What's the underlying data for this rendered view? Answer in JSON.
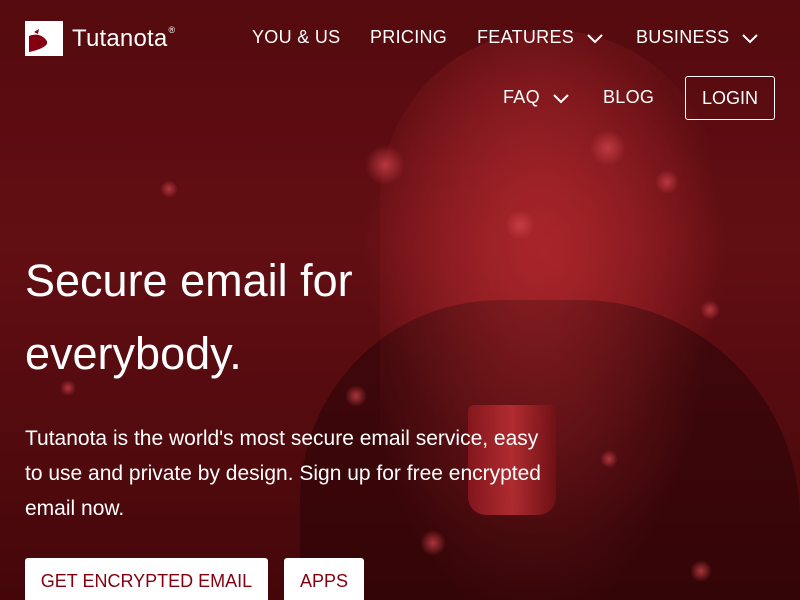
{
  "brand": {
    "logo_text": "Tutanota",
    "registered_mark": "®"
  },
  "nav": {
    "items": [
      {
        "label": "YOU & US",
        "has_dropdown": false
      },
      {
        "label": "PRICING",
        "has_dropdown": false
      },
      {
        "label": "FEATURES",
        "has_dropdown": true
      },
      {
        "label": "BUSINESS",
        "has_dropdown": true
      },
      {
        "label": "FAQ",
        "has_dropdown": true
      },
      {
        "label": "BLOG",
        "has_dropdown": false
      }
    ],
    "login_label": "LOGIN"
  },
  "hero": {
    "headline_line1": "Secure email for",
    "headline_line2": "everybody.",
    "lead": "Tutanota is the world's most secure email service, easy to use and private by design. Sign up for free encrypted email now.",
    "primary_cta": "GET ENCRYPTED EMAIL",
    "secondary_cta": "APPS"
  },
  "colors": {
    "accent": "#840010",
    "background_tint": "#5a0a0d",
    "text": "#ffffff"
  },
  "icons": {
    "dropdown": "chevron-down-icon",
    "logo": "tutanota-logo-icon"
  }
}
